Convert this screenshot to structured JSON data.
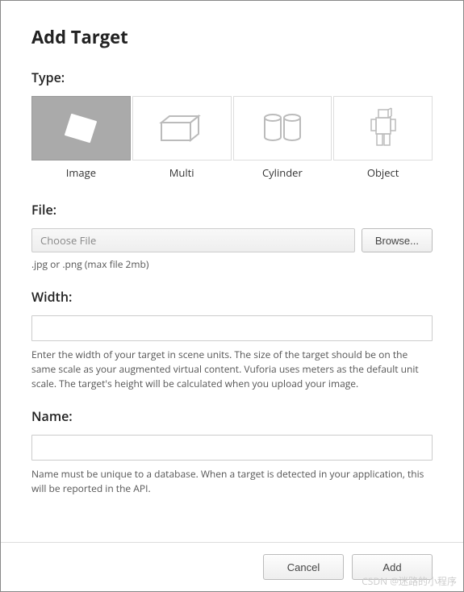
{
  "title": "Add Target",
  "type_section": {
    "label": "Type:",
    "options": [
      {
        "label": "Image",
        "icon": "image-icon",
        "selected": true
      },
      {
        "label": "Multi",
        "icon": "multi-icon",
        "selected": false
      },
      {
        "label": "Cylinder",
        "icon": "cylinder-icon",
        "selected": false
      },
      {
        "label": "Object",
        "icon": "object-icon",
        "selected": false
      }
    ]
  },
  "file_section": {
    "label": "File:",
    "placeholder": "Choose File",
    "browse_button": "Browse...",
    "hint": ".jpg or .png (max file 2mb)"
  },
  "width_section": {
    "label": "Width:",
    "value": "",
    "hint": "Enter the width of your target in scene units. The size of the target should be on the same scale as your augmented virtual content. Vuforia uses meters as the default unit scale. The target's height will be calculated when you upload your image."
  },
  "name_section": {
    "label": "Name:",
    "value": "",
    "hint": "Name must be unique to a database. When a target is detected in your application, this will be reported in the API."
  },
  "footer": {
    "cancel": "Cancel",
    "add": "Add"
  },
  "watermark": "CSDN @迷路的小程序"
}
